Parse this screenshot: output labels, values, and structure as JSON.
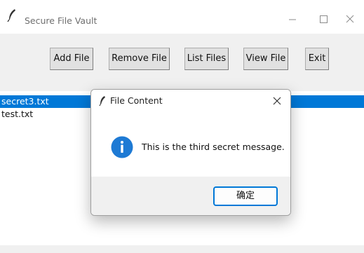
{
  "window": {
    "title": "Secure File Vault",
    "icon": "feather-icon",
    "controls": [
      "minimize-icon",
      "maximize-icon",
      "close-icon"
    ]
  },
  "toolbar": {
    "add_label": "Add File",
    "remove_label": "Remove File",
    "list_label": "List Files",
    "view_label": "View File",
    "exit_label": "Exit"
  },
  "file_list": {
    "items": [
      "secret3.txt",
      "test.txt"
    ],
    "selected_index": 0
  },
  "dialog": {
    "title": "File Content",
    "icon": "feather-icon",
    "close_icon": "close-icon",
    "info_icon": "info-icon",
    "message": "This is the third secret message.",
    "ok_label": "确定"
  },
  "colors": {
    "selection": "#0078d7",
    "info": "#1e7ad4",
    "accent_border": "#0078d7",
    "button_face": "#e1e1e1"
  }
}
